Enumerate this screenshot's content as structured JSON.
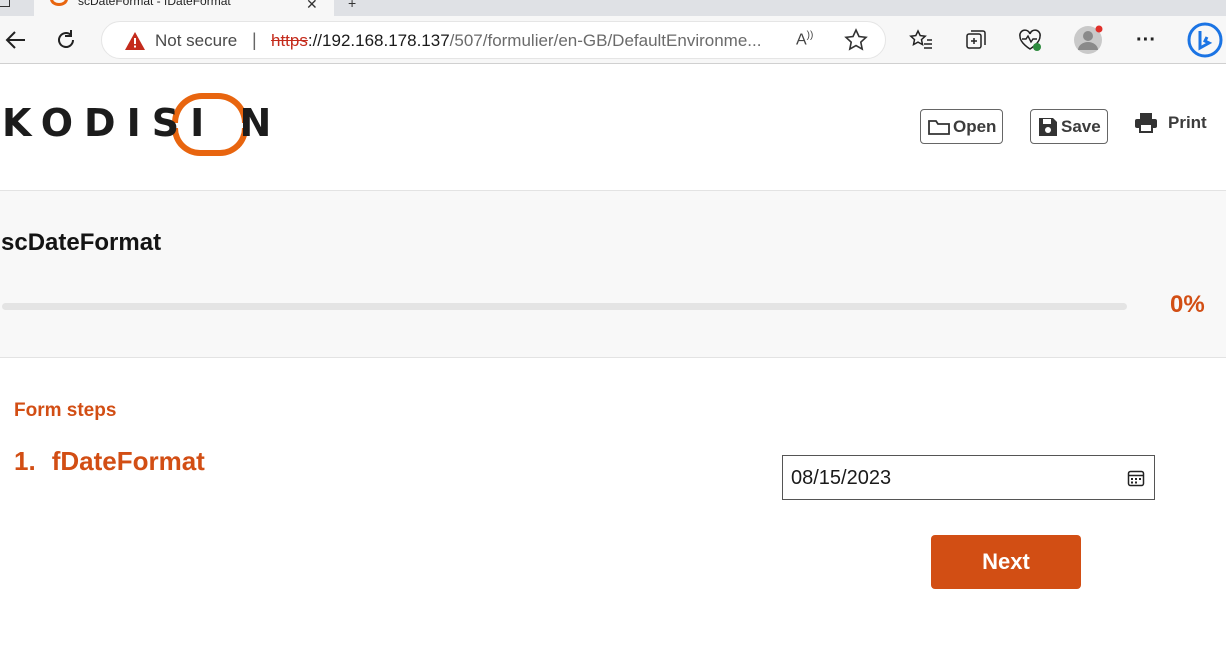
{
  "browser": {
    "tab_title": "scDateFormat - fDateFormat",
    "address": {
      "security_label": "Not secure",
      "separator": "|",
      "url_scheme": "https",
      "url_host": "://192.168.178.137",
      "url_path": "/507/formulier/en-GB/DefaultEnvironme...",
      "read_aloud": "Ȃ"
    }
  },
  "header": {
    "logo_text": "KODISI  N",
    "open_label": "Open",
    "save_label": "Save",
    "print_label": "Print"
  },
  "form": {
    "title": "scDateFormat",
    "progress_fraction": 0.0,
    "progress_label": "0%"
  },
  "steps": {
    "heading": "Form steps",
    "items": [
      {
        "number": "1.",
        "label": "fDateFormat"
      }
    ]
  },
  "date_field": {
    "value": "08/15/2023"
  },
  "actions": {
    "next_label": "Next"
  },
  "colors": {
    "accent": "#d24e14",
    "logo_orange": "#e8650f"
  }
}
